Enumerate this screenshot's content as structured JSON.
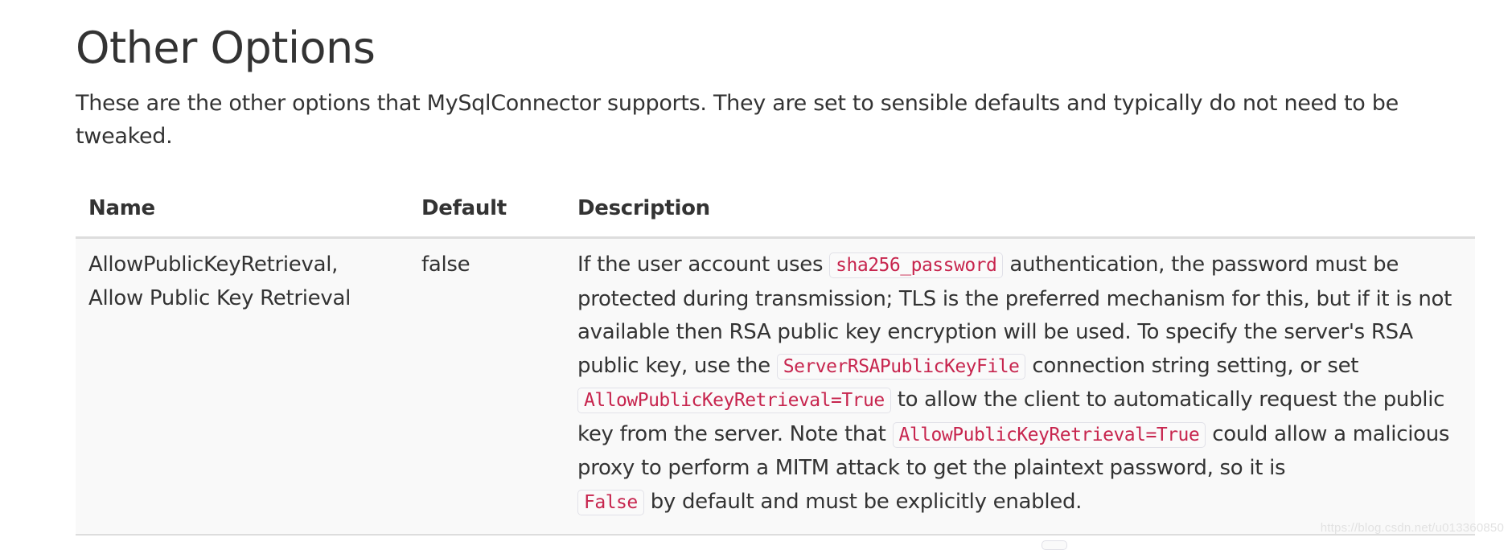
{
  "section": {
    "title": "Other Options",
    "intro": "These are the other options that MySqlConnector supports. They are set to sensible defaults and typically do not need to be tweaked."
  },
  "table": {
    "headers": {
      "name": "Name",
      "default": "Default",
      "description": "Description"
    },
    "rows": [
      {
        "name_line1": "AllowPublicKeyRetrieval,",
        "name_line2": "Allow Public Key Retrieval",
        "default": "false",
        "description": {
          "t1": "If the user account uses ",
          "c1": "sha256_password",
          "t2": " authentication, the password must be protected during transmission; TLS is the preferred mechanism for this, but if it is not available then RSA public key encryption will be used. To specify the server's RSA public key, use the ",
          "c2": "ServerRSAPublicKeyFile",
          "t3": " connection string setting, or set ",
          "c3": "AllowPublicKeyRetrieval=True",
          "t4": " to allow the client to automatically request the public key from the server. Note that ",
          "c4": "AllowPublicKeyRetrieval=True",
          "t5": " could allow a malicious proxy to perform a MITM attack to get the plaintext password, so it is ",
          "c5": "False",
          "t6": " by default and must be explicitly enabled."
        }
      }
    ]
  },
  "watermark": "https://blog.csdn.net/u013360850",
  "colors": {
    "text": "#333333",
    "code_text": "#c7254e",
    "row_background": "#f9f9f9",
    "border": "#dddddd"
  }
}
